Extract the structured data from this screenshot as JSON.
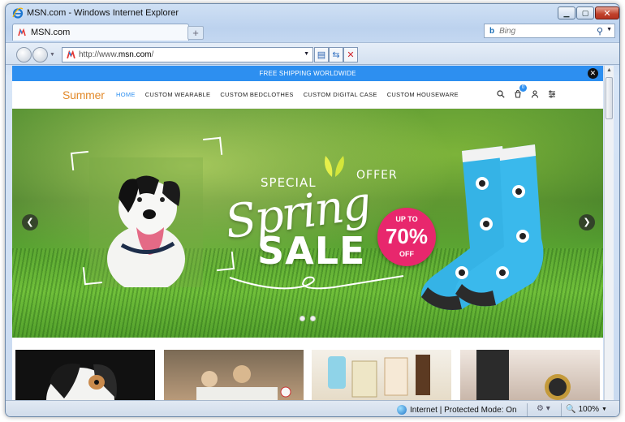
{
  "window": {
    "title": "MSN.com - Windows Internet Explorer"
  },
  "tab": {
    "label": "MSN.com",
    "new_tab_label": "+"
  },
  "search": {
    "placeholder": "Bing"
  },
  "address": {
    "prefix": "http://www.",
    "domain": "msn.com",
    "suffix": "/"
  },
  "site": {
    "shipping_banner": "FREE SHIPPING WORLDWIDE",
    "logo": "Summer",
    "menu": [
      "HOME",
      "CUSTOM WEARABLE",
      "CUSTOM BEDCLOTHES",
      "CUSTOM DIGITAL CASE",
      "CUSTOM HOUSEWARE"
    ],
    "cart_count": "0",
    "hero": {
      "special": "SPECIAL",
      "offer": "OFFER",
      "spring": "Spring",
      "sale": "SALE",
      "badge_top": "UP TO",
      "badge_main": "70%",
      "badge_bottom": "OFF",
      "slide_count": 2,
      "active_slide": 1
    },
    "icons": [
      "search-icon",
      "cart-icon",
      "user-icon",
      "settings-icon"
    ]
  },
  "status": {
    "zone": "Internet | Protected Mode: On",
    "zoom": "100%"
  },
  "colors": {
    "accent": "#2d8ff0",
    "badge": "#e8276d",
    "logo": "#e28a2b"
  }
}
